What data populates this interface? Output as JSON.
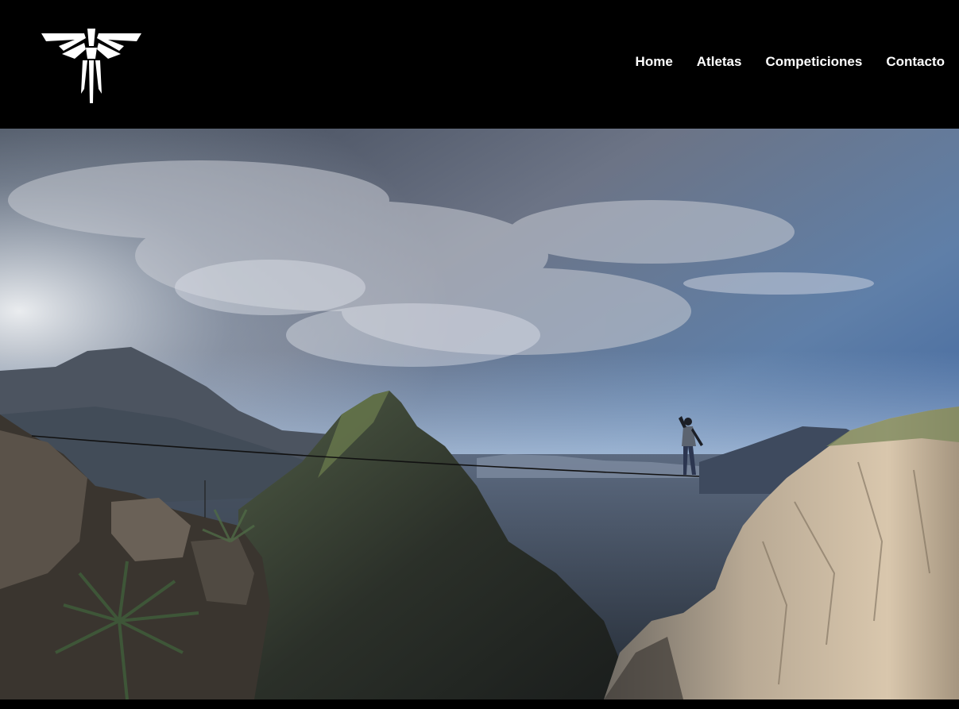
{
  "header": {
    "logo_icon": "firefly-logo-icon",
    "nav": [
      {
        "label": "Home"
      },
      {
        "label": "Atletas"
      },
      {
        "label": "Competiciones"
      },
      {
        "label": "Contacto"
      }
    ]
  },
  "hero": {
    "image": "highline-mountain-photo"
  },
  "colors": {
    "header_bg": "#000000",
    "nav_text": "#ffffff"
  }
}
